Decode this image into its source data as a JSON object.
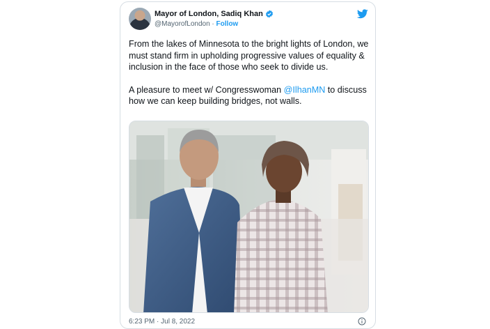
{
  "tweet": {
    "author": {
      "display_name": "Mayor of London, Sadiq Khan",
      "handle": "@MayorofLondon",
      "separator": " · ",
      "follow_label": "Follow",
      "verified": true
    },
    "text": {
      "paragraph1": "From the lakes of Minnesota to the bright lights of London, we must stand firm in upholding progressive values of equality & inclusion in the face of those who seek to divide us.",
      "paragraph2_before": "A pleasure to meet w/ Congresswoman ",
      "mention": "@IlhanMN",
      "paragraph2_after": " to discuss how we can keep building bridges, not walls."
    },
    "timestamp": "6:23 PM · Jul 8, 2022",
    "icons": {
      "logo": "twitter-bird-icon",
      "verified": "verified-badge-icon",
      "info": "info-icon"
    },
    "colors": {
      "accent": "#1d9bf0",
      "text": "#0f1419",
      "secondary": "#536471"
    }
  }
}
